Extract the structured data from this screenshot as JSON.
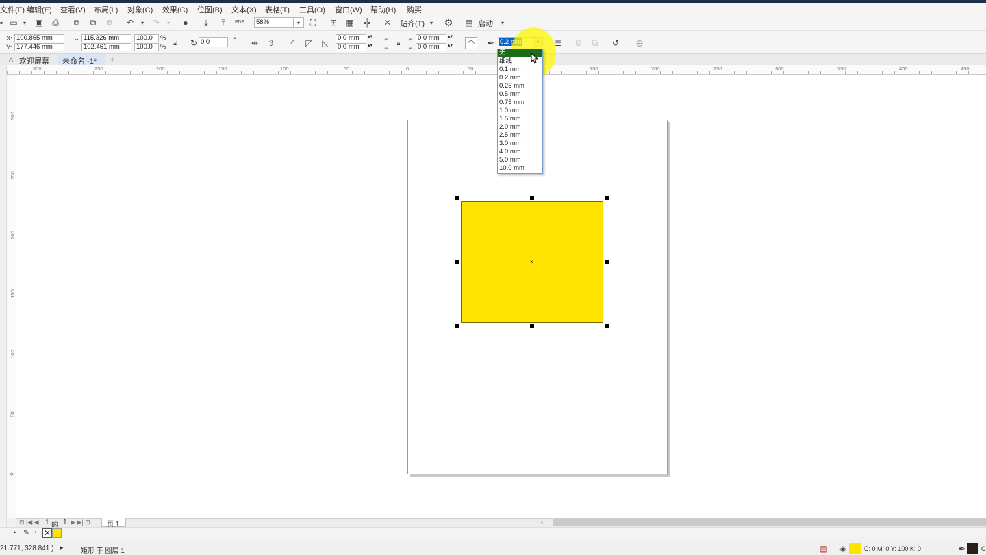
{
  "menu": [
    "文件(F)",
    "编辑(E)",
    "查看(V)",
    "布局(L)",
    "对象(C)",
    "效果(C)",
    "位图(B)",
    "文本(X)",
    "表格(T)",
    "工具(O)",
    "窗口(W)",
    "帮助(H)",
    "购买"
  ],
  "toolbar": {
    "zoom": "58%",
    "paste_label": "贴齐(T)",
    "launch_label": "启动"
  },
  "properties": {
    "x_label": "X:",
    "x": "100.865 mm",
    "y_label": "Y:",
    "y": "177.446 mm",
    "width": "115.326 mm",
    "height": "102.461 mm",
    "scale_x": "100.0",
    "scale_y": "100.0",
    "pct": "%",
    "rotation": "0.0",
    "corner1": "0.0 mm",
    "corner2": "0.0 mm",
    "corner3": "0.0 mm",
    "corner4": "0.0 mm",
    "outline_width": "0.2 mm"
  },
  "tabs": [
    "欢迎屏幕",
    "未命名 -1*"
  ],
  "ruler_top": [
    "300",
    "250",
    "200",
    "150",
    "100",
    "50",
    "0",
    "50",
    "100",
    "150",
    "200",
    "250",
    "300",
    "350",
    "400",
    "450"
  ],
  "ruler_left": [
    "300",
    "250",
    "200",
    "150",
    "100",
    "50",
    "0"
  ],
  "outline_options": [
    "无",
    "细线",
    "0.1 mm",
    "0.2 mm",
    "0.25 mm",
    "0.5 mm",
    "0.75 mm",
    "1.0 mm",
    "1.5 mm",
    "2.0 mm",
    "2.5 mm",
    "3.0 mm",
    "4.0 mm",
    "5.0 mm",
    "10.0 mm"
  ],
  "outline_selected_index": 0,
  "pagebar": {
    "page_current": "1",
    "page_of": "的",
    "page_total": "1",
    "page_tab": "页 1"
  },
  "status": {
    "coords": "21.771, 328.841 )",
    "object_info": "矩形 于 图层 1",
    "color_info": "C: 0 M: 0 Y: 100 K: 0",
    "trail": "C"
  },
  "colors": {
    "fill": "#ffe400",
    "outline_swatch": "#2a1e1a",
    "dropdown_selected": "#1a6e1a"
  }
}
